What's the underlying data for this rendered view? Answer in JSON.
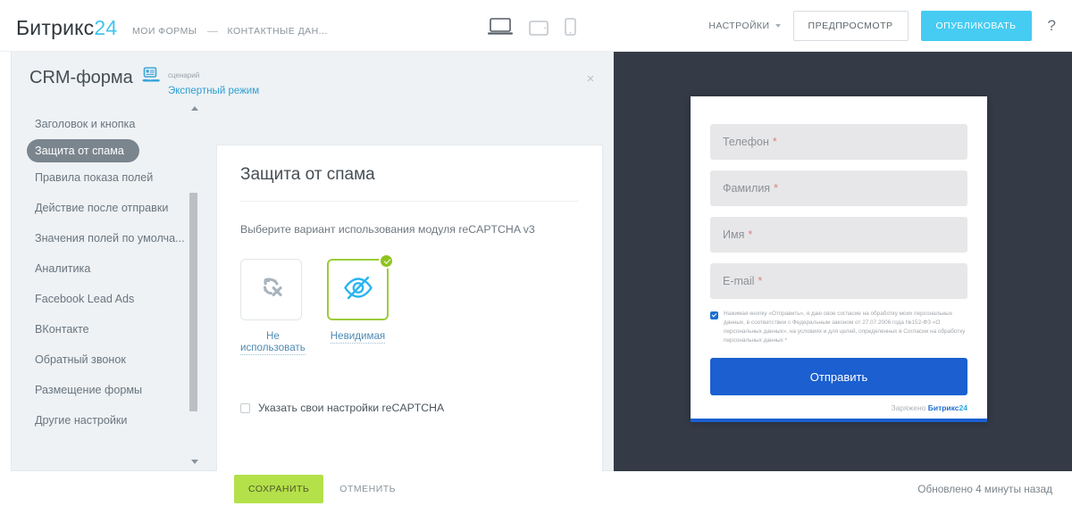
{
  "topbar": {
    "logo_text": "Битрикс",
    "logo_num": "24",
    "breadcrumb": [
      {
        "label": "МОИ ФОРМЫ"
      },
      {
        "label": "КОНТАКТНЫЕ ДАН..."
      }
    ],
    "devices": [
      {
        "name": "desktop-preview-icon",
        "active": true
      },
      {
        "name": "tablet-preview-icon",
        "active": false
      },
      {
        "name": "mobile-preview-icon",
        "active": false
      }
    ],
    "settings_label": "НАСТРОЙКИ",
    "preview_label": "ПРЕДПРОСМОТР",
    "publish_label": "ОПУБЛИКОВАТЬ",
    "help_label": "?",
    "accent_blue": "#46ccf3"
  },
  "editor": {
    "title": "CRM-форма",
    "scenario_caption": "сценарий",
    "scenario_value": "Экспертный режим",
    "close_label": "×",
    "sidebar": [
      {
        "label": "Заголовок и кнопка",
        "active": false
      },
      {
        "label": "Защита от спама",
        "active": true
      },
      {
        "label": "Правила показа полей",
        "active": false
      },
      {
        "label": "Действие после отправки",
        "active": false
      },
      {
        "label": "Значения полей по умолча...",
        "active": false
      },
      {
        "label": "Аналитика",
        "active": false
      },
      {
        "label": "Facebook Lead Ads",
        "active": false
      },
      {
        "label": "ВКонтакте",
        "active": false
      },
      {
        "label": "Обратный звонок",
        "active": false
      },
      {
        "label": "Размещение формы",
        "active": false
      },
      {
        "label": "Другие настройки",
        "active": false
      }
    ],
    "content": {
      "heading": "Защита от спама",
      "subtitle": "Выберите вариант использования модуля reCAPTCHA v3",
      "options": [
        {
          "label": "Не использовать",
          "icon": "captcha-disabled-icon",
          "selected": false
        },
        {
          "label": "Невидимая",
          "icon": "eye-hidden-icon",
          "selected": true
        }
      ],
      "custom_settings_checkbox": {
        "label": "Указать свои настройки reCAPTCHA",
        "checked": false
      },
      "selected_color": "#9bcc3a"
    }
  },
  "preview": {
    "fields": [
      {
        "label": "Телефон",
        "required": "*"
      },
      {
        "label": "Фамилия",
        "required": "*"
      },
      {
        "label": "Имя",
        "required": "*"
      },
      {
        "label": "E-mail",
        "required": "*"
      }
    ],
    "consent": {
      "checked": true,
      "text": "Нажимая кнопку «Отправить», я даю свое согласие на обработку моих персональных данных, в соответствии с Федеральным законом от 27.07.2006 года №152-ФЗ «О персональных данных», на условиях и для целей, определенных в Согласии на обработку персональных данных *"
    },
    "submit_label": "Отправить",
    "powered_prefix": "Заряжено ",
    "powered_brand": "Битрикс",
    "powered_num": "24",
    "button_color": "#1b5fd0"
  },
  "bottombar": {
    "save_label": "СОХРАНИТЬ",
    "cancel_label": "ОТМЕНИТЬ",
    "updated_text": "Обновлено 4 минуты назад",
    "save_color": "#b4e04a"
  }
}
